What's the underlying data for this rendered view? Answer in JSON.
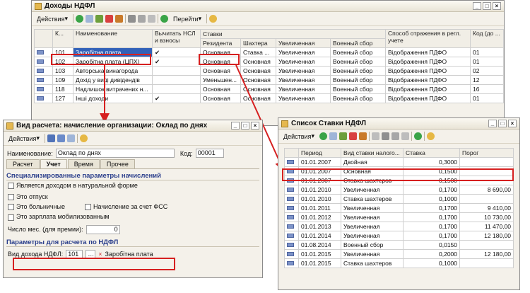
{
  "main": {
    "title": "Доходы НДФЛ",
    "toolbar": {
      "actions": "Действия",
      "goto": "Перейти"
    },
    "headers": {
      "code": "К...",
      "name": "Наименование",
      "deduct": "Вычитать НСЛ и взносы",
      "rates": "Ставки",
      "resident": "Резидента",
      "miner": "Шахтера",
      "increased": "Увеличенная",
      "military": "Военный сбор",
      "method": "Способ отражения в регл. учете",
      "code2": "Код (до ..."
    },
    "rows": [
      {
        "code": "101",
        "name": "Заробітна плата",
        "deduct": "✔",
        "resident": "Основная",
        "miner": "Ставка ...",
        "increased": "Увеличенная",
        "military": "Военный сбор",
        "method": "Відображення ПДФО",
        "code2": "01"
      },
      {
        "code": "102",
        "name": "Заробітна плата (ЦПХ)",
        "deduct": "✔",
        "resident": "Основная",
        "miner": "Основная",
        "increased": "Увеличенная",
        "military": "Военный сбор",
        "method": "Відображення ПДФО",
        "code2": "01"
      },
      {
        "code": "103",
        "name": "Авторська винагорода",
        "deduct": "",
        "resident": "Основная",
        "miner": "Основная",
        "increased": "Увеличенная",
        "military": "Военный сбор",
        "method": "Відображення ПДФО",
        "code2": "02"
      },
      {
        "code": "109",
        "name": "Дохід у виді дивідендів",
        "deduct": "",
        "resident": "Уменьшен...",
        "miner": "Основная",
        "increased": "Увеличенная",
        "military": "Военный сбор",
        "method": "Відображення ПДФО",
        "code2": "12"
      },
      {
        "code": "118",
        "name": "Надлишок витрачених н...",
        "deduct": "",
        "resident": "Основная",
        "miner": "Основная",
        "increased": "Увеличенная",
        "military": "Военный сбор",
        "method": "Відображення ПДФО",
        "code2": "16"
      },
      {
        "code": "127",
        "name": "Інші доходи",
        "deduct": "✔",
        "resident": "Основная",
        "miner": "Основная",
        "increased": "Увеличенная",
        "military": "Военный сбор",
        "method": "Відображення ПДФО",
        "code2": "01"
      }
    ]
  },
  "calc": {
    "title": "Вид расчета: начисление организации: Оклад по днях",
    "actions": "Действия",
    "name_label": "Наименование:",
    "name_value": "Оклад по днях",
    "code_label": "Код:",
    "code_value": "00001",
    "tabs": [
      "Расчет",
      "Учет",
      "Время",
      "Прочее"
    ],
    "section1": "Специализированные параметры начислений",
    "cb_natural": "Является доходом в натуральной форме",
    "cb_vacation": "Это отпуск",
    "cb_sick": "Это больничные",
    "cb_fss": "Начисление за счет ФСС",
    "cb_mobilized": "Это зарплата мобилизованным",
    "months_label": "Число мес. (для премии):",
    "months_value": "0",
    "section2": "Параметры для расчета по НДФЛ",
    "income_label": "Вид дохода НДФЛ:",
    "income_code": "101",
    "income_name": "Заробітна плата"
  },
  "rates": {
    "title": "Список Ставки НДФЛ",
    "actions": "Действия",
    "headers": {
      "period": "Период",
      "type": "Вид ставки налого...",
      "rate": "Ставка",
      "threshold": "Порог"
    },
    "rows": [
      {
        "period": "01.01.2007",
        "type": "Двойная",
        "rate": "0,3000",
        "threshold": ""
      },
      {
        "period": "01.01.2007",
        "type": "Основная",
        "rate": "0,1500",
        "threshold": ""
      },
      {
        "period": "01.01.2007",
        "type": "Ставка шахтеров",
        "rate": "0,1500",
        "threshold": ""
      },
      {
        "period": "01.01.2010",
        "type": "Увеличенная",
        "rate": "0,1700",
        "threshold": "8 690,00"
      },
      {
        "period": "01.01.2010",
        "type": "Ставка шахтеров",
        "rate": "0,1000",
        "threshold": ""
      },
      {
        "period": "01.01.2011",
        "type": "Увеличенная",
        "rate": "0,1700",
        "threshold": "9 410,00"
      },
      {
        "period": "01.01.2012",
        "type": "Увеличенная",
        "rate": "0,1700",
        "threshold": "10 730,00"
      },
      {
        "period": "01.01.2013",
        "type": "Увеличенная",
        "rate": "0,1700",
        "threshold": "11 470,00"
      },
      {
        "period": "01.01.2014",
        "type": "Увеличенная",
        "rate": "0,1700",
        "threshold": "12 180,00"
      },
      {
        "period": "01.08.2014",
        "type": "Военный сбор",
        "rate": "0,0150",
        "threshold": ""
      },
      {
        "period": "01.01.2015",
        "type": "Увеличенная",
        "rate": "0,2000",
        "threshold": "12 180,00"
      },
      {
        "period": "01.01.2015",
        "type": "Ставка шахтеров",
        "rate": "0,1000",
        "threshold": ""
      }
    ]
  },
  "colors": {
    "accent": "#3161b8",
    "highlight": "#d62020"
  }
}
